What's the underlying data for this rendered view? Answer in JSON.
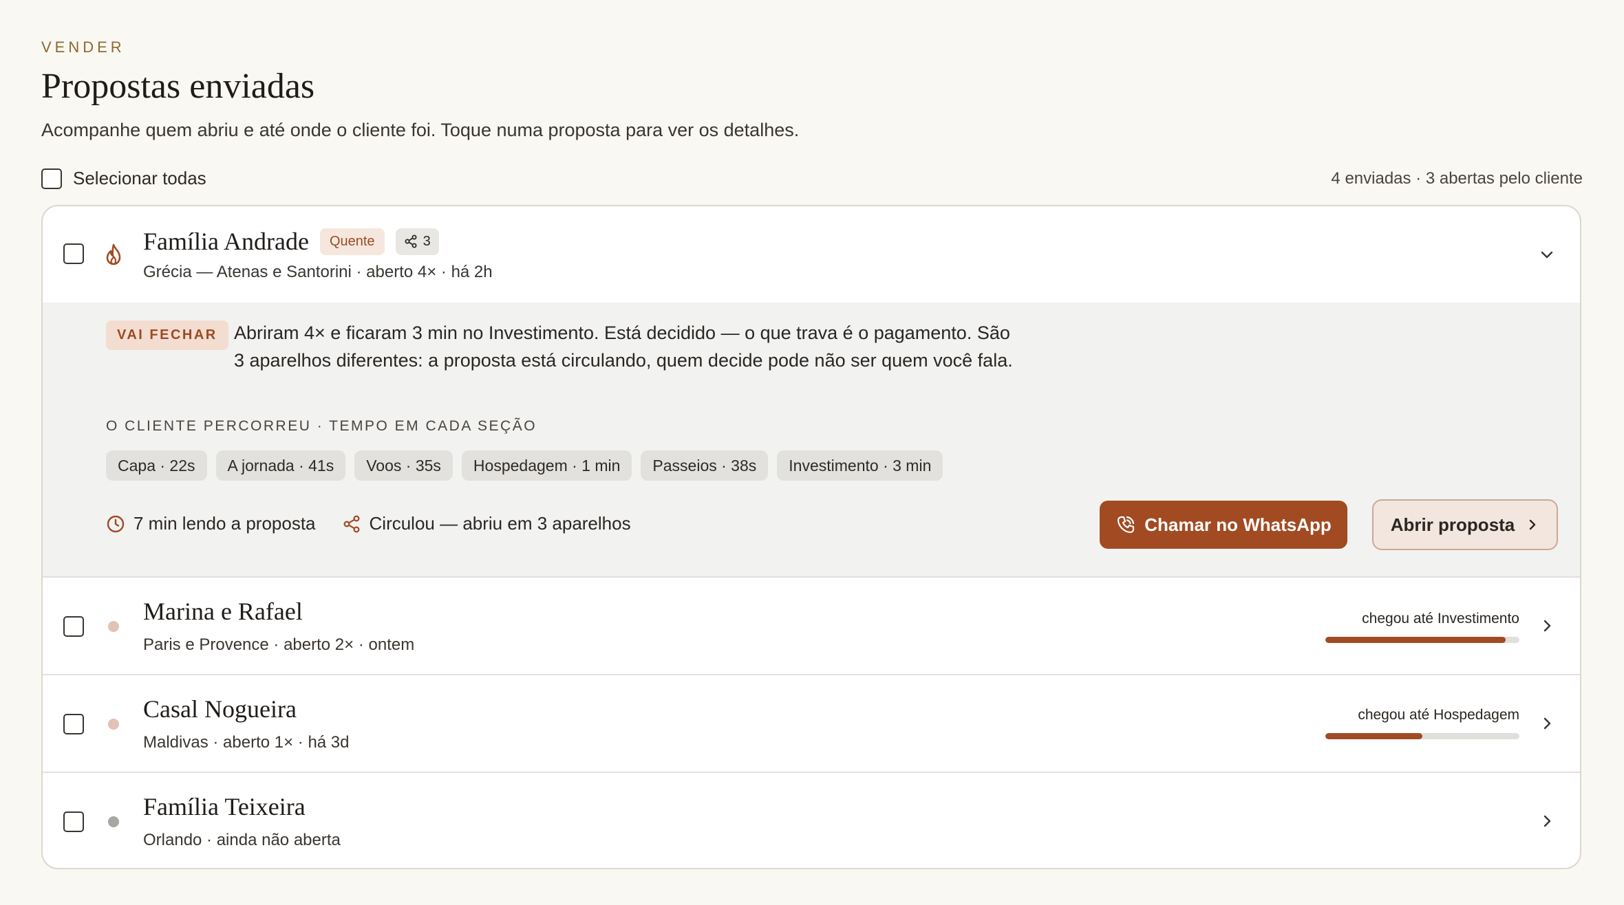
{
  "section_label": "VENDER",
  "page_title": "Propostas enviadas",
  "page_subtitle": "Acompanhe quem abriu e até onde o cliente foi. Toque numa proposta para ver os detalhes.",
  "select_all_label": "Selecionar todas",
  "counts_text": "4 enviadas · 3 abertas pelo cliente",
  "colors": {
    "accent": "#a24a22",
    "hot_dot": "#e2c2b2",
    "cold_dot": "#a8a6a3"
  },
  "proposals": [
    {
      "name": "Família Andrade",
      "tag": "Quente",
      "share_count": "3",
      "meta": "Grécia — Atenas e Santorini · aberto 4× · há 2h",
      "icon": "flame-icon",
      "expanded": true,
      "verdict_badge": "VAI FECHAR",
      "insight": "Abriram 4× e ficaram 3 min no Investimento. Está decidido — o que trava é o pagamento. São 3 aparelhos diferentes: a proposta está circulando, quem decide pode não ser quem você fala.",
      "sections_label": "O CLIENTE PERCORREU · TEMPO EM CADA SEÇÃO",
      "sections": [
        "Capa · 22s",
        "A jornada · 41s",
        "Voos · 35s",
        "Hospedagem · 1 min",
        "Passeios · 38s",
        "Investimento · 3 min"
      ],
      "reading_time": "7 min lendo a proposta",
      "devices": "Circulou — abriu em 3 aparelhos",
      "whatsapp_label": "Chamar no WhatsApp",
      "open_label": "Abrir proposta"
    },
    {
      "name": "Marina e Rafael",
      "meta": "Paris e Provence · aberto 2× · ontem",
      "progress_label": "chegou até Investimento",
      "progress": 0.93
    },
    {
      "name": "Casal Nogueira",
      "meta": "Maldivas · aberto 1× · há 3d",
      "progress_label": "chegou até Hospedagem",
      "progress": 0.5
    },
    {
      "name": "Família Teixeira",
      "meta": "Orlando · ainda não aberta"
    }
  ]
}
